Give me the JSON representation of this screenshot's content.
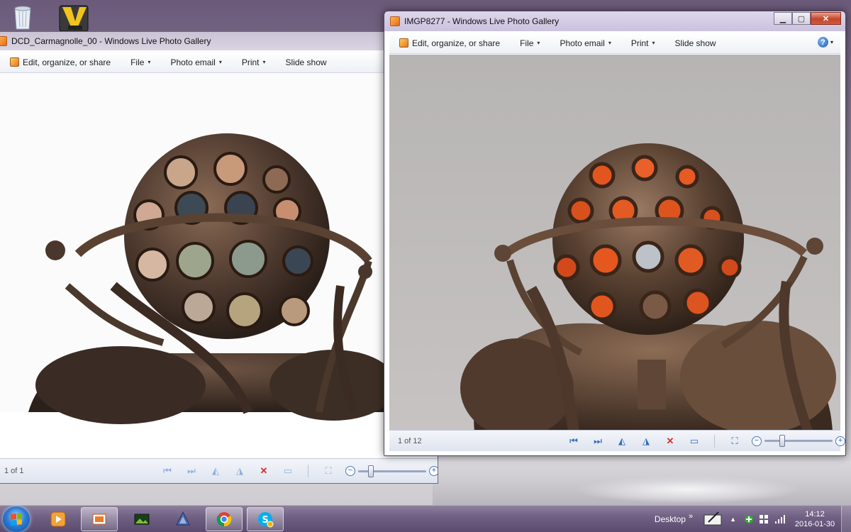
{
  "left_window": {
    "title": "DCD_Carmagnolle_00 - Windows Live Photo Gallery",
    "toolbar": {
      "edit": "Edit, organize, or share",
      "file": "File",
      "photo_email": "Photo email",
      "print": "Print",
      "slide_show": "Slide show"
    },
    "status": {
      "count": "1 of 1",
      "zoom_level": 0.16
    }
  },
  "right_window": {
    "title": "IMGP8277 - Windows Live Photo Gallery",
    "toolbar": {
      "edit": "Edit, organize, or share",
      "file": "File",
      "photo_email": "Photo email",
      "print": "Print",
      "slide_show": "Slide show",
      "help_icon": "?"
    },
    "status": {
      "count": "1 of 12",
      "zoom_level": 0.24
    }
  },
  "icons": {
    "prev": "⏮",
    "next": "⏭",
    "rotate_left": "◭",
    "rotate_right": "◮",
    "delete": "✕",
    "slideshow": "▭",
    "fit": "⛶",
    "zoom_out": "−",
    "zoom_in": "+",
    "caret": "▾",
    "minimize": "▁",
    "maximize": "▢",
    "close": "✕"
  },
  "taskbar": {
    "desktop_label": "Desktop",
    "overflow": "»",
    "time": "14:12",
    "date": "2016-01-30"
  },
  "colors": {
    "accent_blue": "#2f6cc4",
    "delete_red": "#d8302a",
    "taskbar": "#6e5f83"
  }
}
